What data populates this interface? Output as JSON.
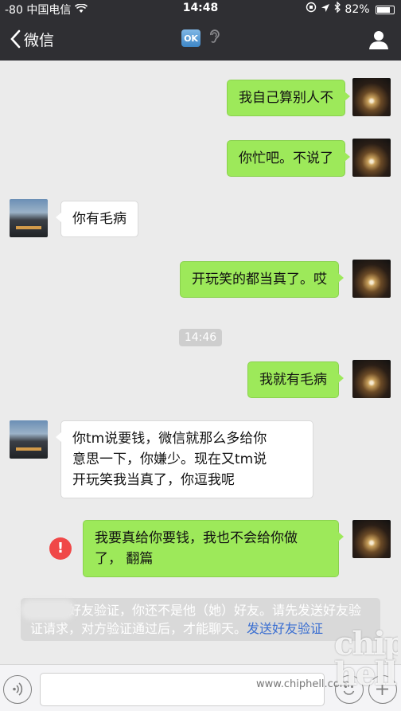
{
  "status_bar": {
    "signal": "-80",
    "carrier": "中国电信",
    "time": "14:48",
    "battery": "82%",
    "battery_level": 0.82
  },
  "nav": {
    "back_label": "微信",
    "title_emoji": "OK",
    "title_icon": "ear-icon",
    "profile_icon": "person-icon"
  },
  "messages": [
    {
      "side": "me",
      "text": "我自己算别人不"
    },
    {
      "side": "me",
      "text": "你忙吧。不说了"
    },
    {
      "side": "other",
      "text": "你有毛病"
    },
    {
      "side": "me",
      "text": "开玩笑的都当真了。哎"
    },
    {
      "side": "me",
      "text": "我就有毛病"
    },
    {
      "side": "other",
      "lines": [
        "你tm说要钱，微信就那么多给你",
        "意思一下，你嫌少。现在又tm说",
        "开玩笑我当真了，你逗我呢"
      ]
    },
    {
      "side": "me",
      "lines": [
        "我要真给你要钱，我也不会给你做",
        "了，  翻篇"
      ],
      "failed": true
    }
  ],
  "timestamp": "14:46",
  "error_mark": "!",
  "system_note": {
    "text": "开启了好友验证，你还不是他（她）好友。请先发送好友验证请求，对方验证通过后，才能聊天。",
    "link": "发送好友验证"
  },
  "watermark": {
    "site": "www.chiphell.com",
    "logo": "chip hell"
  },
  "colors": {
    "nav_bg": "#2f2f33",
    "chat_bg": "#ebebeb",
    "my_bubble": "#9de95a",
    "other_bubble": "#ffffff",
    "error_red": "#f04848",
    "link_blue": "#3b6fd1"
  }
}
